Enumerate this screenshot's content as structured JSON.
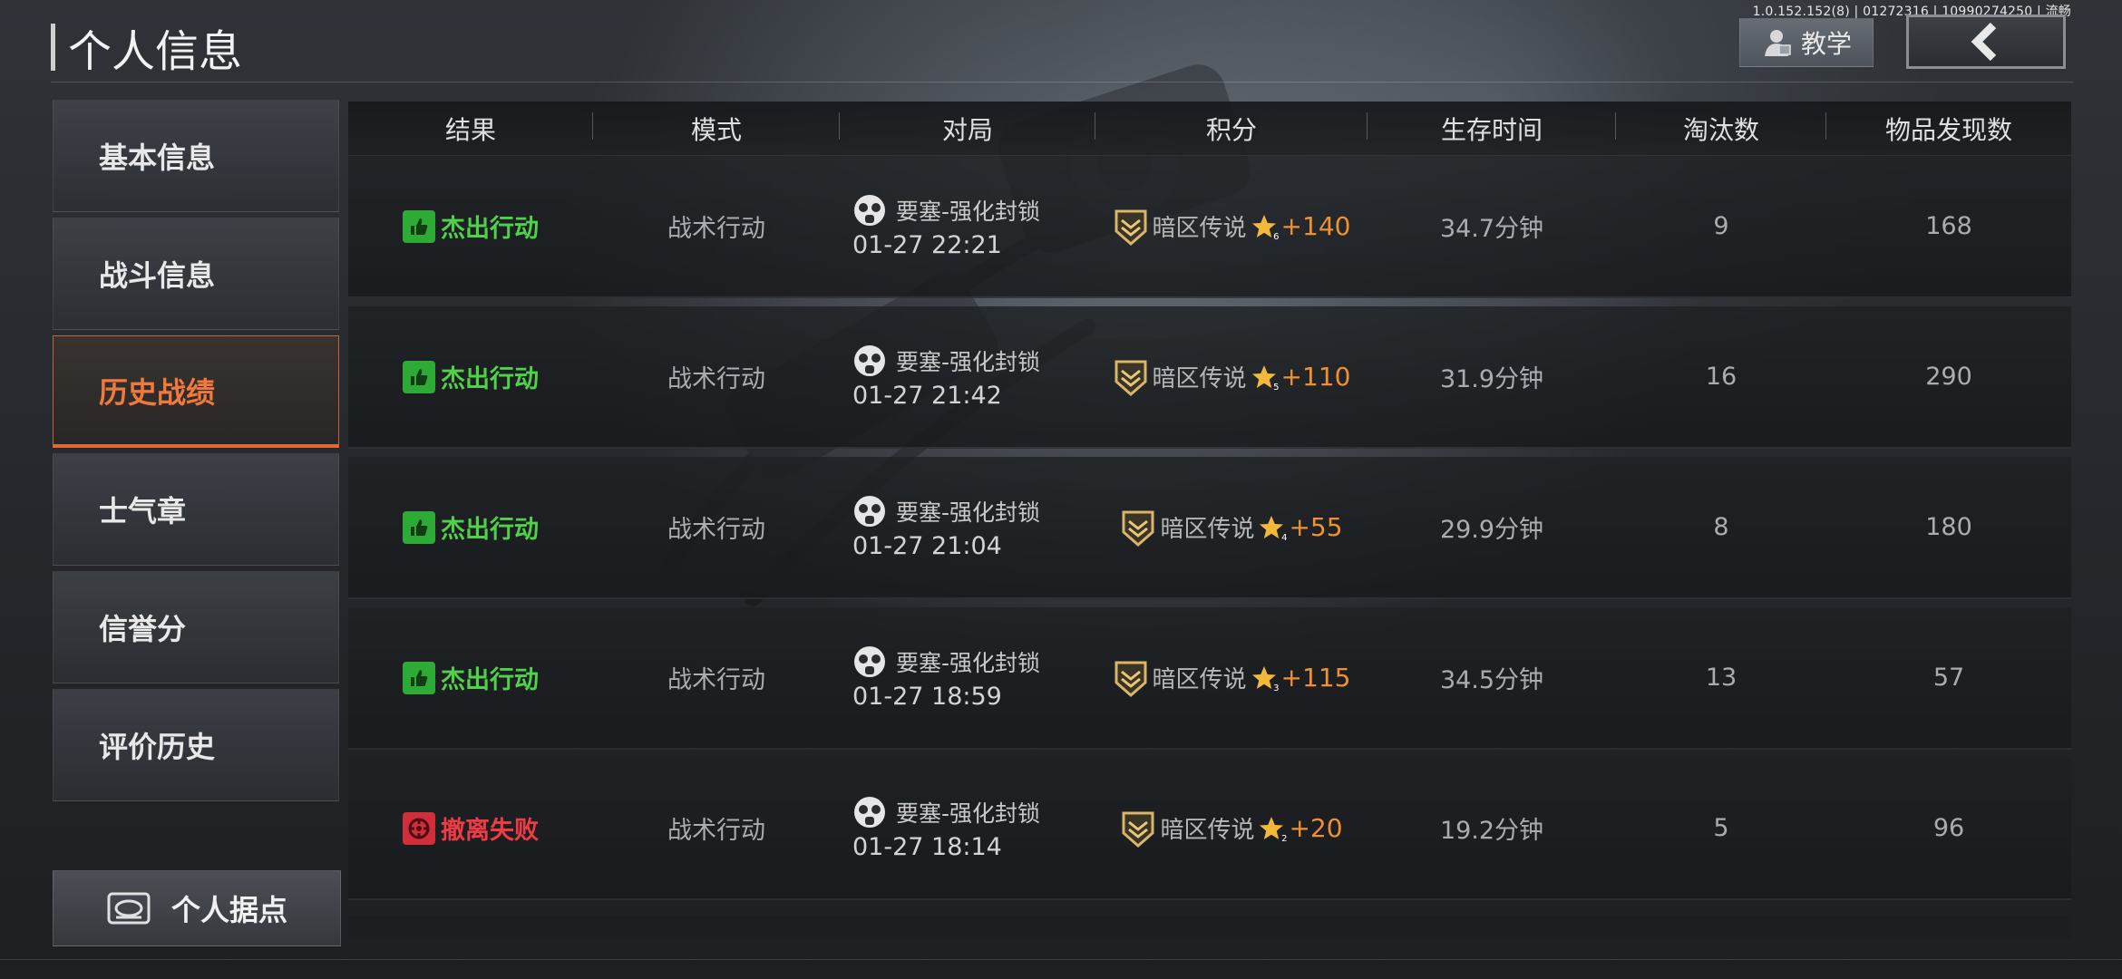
{
  "build_info": "1.0.152.152(8) | 01272316 | 10990274250 | 流畅",
  "header": {
    "title": "个人信息",
    "tutorial_label": "教学"
  },
  "sidebar": {
    "items": [
      {
        "label": "基本信息",
        "active": false
      },
      {
        "label": "战斗信息",
        "active": false
      },
      {
        "label": "历史战绩",
        "active": true
      },
      {
        "label": "士气章",
        "active": false
      },
      {
        "label": "信誉分",
        "active": false
      },
      {
        "label": "评价历史",
        "active": false
      }
    ],
    "base_button_label": "个人据点"
  },
  "table": {
    "columns": [
      "结果",
      "模式",
      "对局",
      "积分",
      "生存时间",
      "淘汰数",
      "物品发现数"
    ],
    "rows": [
      {
        "result": "杰出行动",
        "result_status": "success",
        "mode": "战术行动",
        "map": "要塞-强化封锁",
        "time": "01-27 22:21",
        "rank": "暗区传说",
        "star": "6",
        "score": "+140",
        "survival": "34.7分钟",
        "kills": "9",
        "items": "168"
      },
      {
        "result": "杰出行动",
        "result_status": "success",
        "mode": "战术行动",
        "map": "要塞-强化封锁",
        "time": "01-27 21:42",
        "rank": "暗区传说",
        "star": "5",
        "score": "+110",
        "survival": "31.9分钟",
        "kills": "16",
        "items": "290"
      },
      {
        "result": "杰出行动",
        "result_status": "success",
        "mode": "战术行动",
        "map": "要塞-强化封锁",
        "time": "01-27 21:04",
        "rank": "暗区传说",
        "star": "4",
        "score": "+55",
        "survival": "29.9分钟",
        "kills": "8",
        "items": "180"
      },
      {
        "result": "杰出行动",
        "result_status": "success",
        "mode": "战术行动",
        "map": "要塞-强化封锁",
        "time": "01-27 18:59",
        "rank": "暗区传说",
        "star": "3",
        "score": "+115",
        "survival": "34.5分钟",
        "kills": "13",
        "items": "57"
      },
      {
        "result": "撤离失败",
        "result_status": "fail",
        "mode": "战术行动",
        "map": "要塞-强化封锁",
        "time": "01-27 18:14",
        "rank": "暗区传说",
        "star": "2",
        "score": "+20",
        "survival": "19.2分钟",
        "kills": "5",
        "items": "96"
      }
    ]
  },
  "colors": {
    "accent": "#e06a34",
    "success": "#4fd24a",
    "fail": "#ef3b45",
    "score": "#f0902e"
  }
}
